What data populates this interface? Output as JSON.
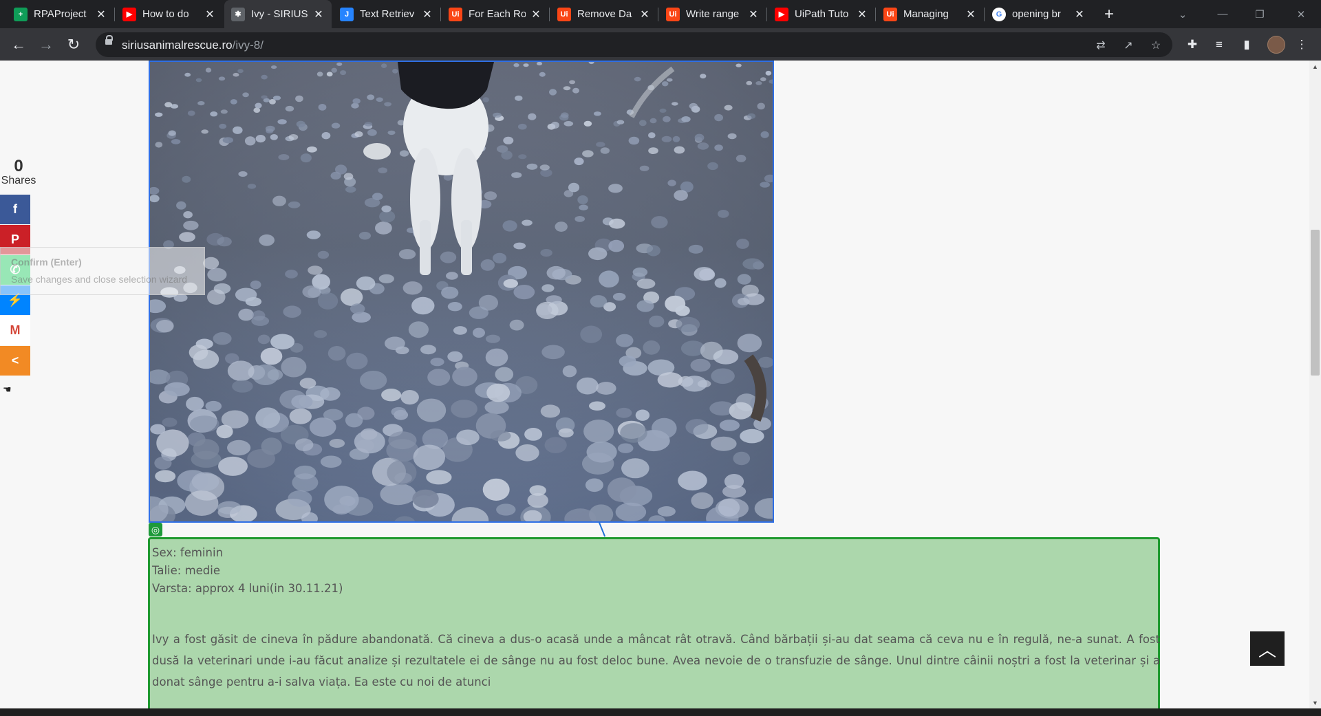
{
  "browser": {
    "tabs": [
      {
        "title": "RPAProject",
        "icon": "sheets-icon",
        "color": "#0f9d58",
        "glyph": "+"
      },
      {
        "title": "How to do",
        "icon": "youtube-icon",
        "color": "#ff0000",
        "glyph": "▶"
      },
      {
        "title": "Ivy - SIRIUS",
        "icon": "paw-icon",
        "color": "#5f6368",
        "glyph": "✱"
      },
      {
        "title": "Text Retriev",
        "icon": "jira-icon",
        "color": "#2684ff",
        "glyph": "J"
      },
      {
        "title": "For Each Ro",
        "icon": "uipath-icon",
        "color": "#fa4616",
        "glyph": "Ui"
      },
      {
        "title": "Remove Da",
        "icon": "uipath-icon",
        "color": "#fa4616",
        "glyph": "Ui"
      },
      {
        "title": "Write range",
        "icon": "uipath-icon",
        "color": "#fa4616",
        "glyph": "Ui"
      },
      {
        "title": "UiPath Tuto",
        "icon": "youtube-icon",
        "color": "#ff0000",
        "glyph": "▶"
      },
      {
        "title": "Managing",
        "icon": "uipath-icon",
        "color": "#fa4616",
        "glyph": "Ui"
      },
      {
        "title": "opening br",
        "icon": "google-icon",
        "color": "#ffffff",
        "glyph": "G"
      }
    ],
    "url_host": "siriusanimalrescue.ro",
    "url_path": "/ivy-8/"
  },
  "shares": {
    "count": "0",
    "label": "Shares",
    "buttons": [
      {
        "name": "facebook-share",
        "icon": "facebook-icon",
        "glyph": "f",
        "color": "#3b5998"
      },
      {
        "name": "pinterest-share",
        "icon": "pinterest-icon",
        "glyph": "P",
        "color": "#cb2027"
      },
      {
        "name": "whatsapp-share",
        "icon": "whatsapp-icon",
        "glyph": "✆",
        "color": "#25d366"
      },
      {
        "name": "messenger-share",
        "icon": "messenger-icon",
        "glyph": "⚡",
        "color": "#0084ff"
      },
      {
        "name": "gmail-share",
        "icon": "gmail-icon",
        "glyph": "M",
        "color": "#ffffff"
      },
      {
        "name": "more-share",
        "icon": "share-icon",
        "glyph": "<",
        "color": "#f28a24"
      }
    ]
  },
  "tooltip": {
    "title": "Confirm (Enter)",
    "description": "Save changes and close selection wizard"
  },
  "content": {
    "sex": "Sex: feminin",
    "talie": "Talie: medie",
    "varsta": "Varsta: approx 4 luni(in 30.11.21)",
    "story": "Ivy a fost găsit de cineva în pădure abandonată. Că cineva a dus-o acasă unde a mâncat rât otravă. Când bărbații și-au dat seama că ceva nu e în regulă, ne-a sunat. A fost dusă la veterinari unde i-au făcut analize și rezultatele ei de sânge nu au fost deloc bune. Avea nevoie de o transfuzie de sânge. Unul dintre câinii noștri a fost la veterinar și a donat sânge pentru a-i salva viața. Ea este cu noi de atunci"
  },
  "colors": {
    "selection_green": "#1f9a30",
    "selection_fill": "#acd7ac",
    "selection_blue": "#2f6fe6"
  }
}
